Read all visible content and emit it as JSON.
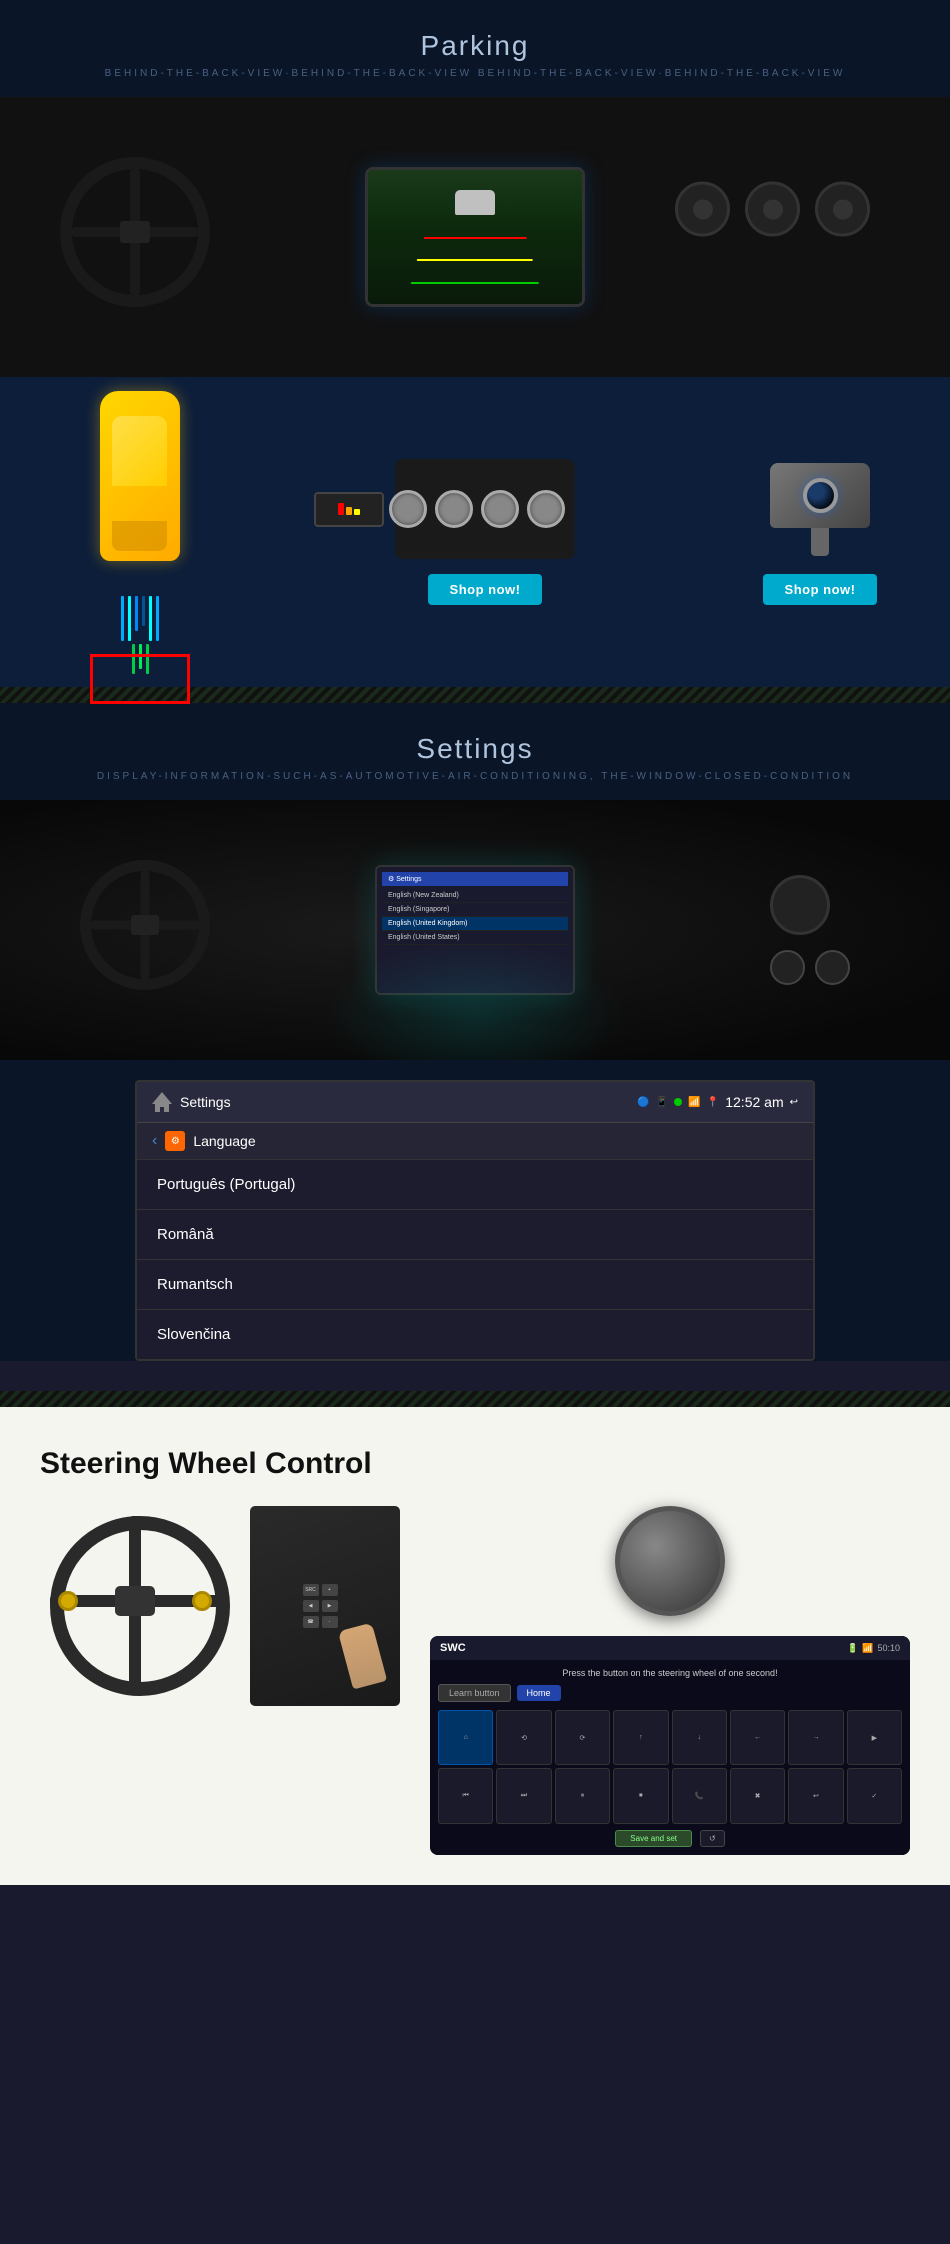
{
  "parking": {
    "title": "Parking",
    "subtitle": "BEHIND-THE-BACK-VIEW·BEHIND-THE-BACK-VIEW BEHIND-THE-BACK-VIEW·BEHIND-THE-BACK-VIEW",
    "sensor_shop_btn": "Shop now!",
    "camera_shop_btn": "Shop now!",
    "language_items": [
      "English (New Zealand)",
      "English (Singapore)",
      "English (United Kingdom)",
      "English (United States)"
    ]
  },
  "settings": {
    "title": "Settings",
    "subtitle": "DISPLAY-INFORMATION-SUCH-AS-AUTOMOTIVE-AIR-CONDITIONING, THE-WINDOW-CLOSED-CONDITION",
    "ui_title": "Settings",
    "time": "12:52 am",
    "sub_title": "Language",
    "language_list": [
      "Português (Portugal)",
      "Română",
      "Rumantsch",
      "Slovenčina"
    ]
  },
  "steering": {
    "title": "Steering Wheel Control",
    "swc_title": "SWC",
    "instruction": "Press the button on the steering wheel of one second!",
    "learn_label": "Learn button",
    "home_label": "Home",
    "save_label": "Save and set",
    "reset_label": "↺",
    "status_time": "50:10",
    "icons": [
      "⌂",
      "⟲",
      "⟳",
      "↑",
      "↓",
      "←",
      "→",
      "▶",
      "⏮",
      "⏭",
      "⏸",
      "⏹",
      "📞",
      "✖",
      "↩",
      "✓"
    ]
  }
}
